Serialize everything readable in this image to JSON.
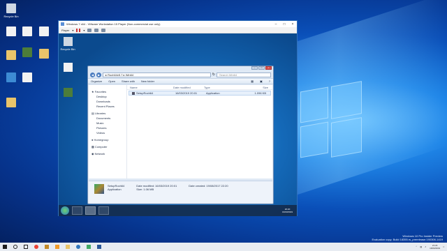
{
  "desktop_icons": [
    {
      "label": "Recycle Bin"
    },
    {
      "label": ""
    },
    {
      "label": ""
    },
    {
      "label": ""
    },
    {
      "label": ""
    },
    {
      "label": ""
    },
    {
      "label": ""
    },
    {
      "label": ""
    },
    {
      "label": ""
    },
    {
      "label": ""
    },
    {
      "label": ""
    },
    {
      "label": ""
    },
    {
      "label": ""
    },
    {
      "label": ""
    }
  ],
  "vmware": {
    "title": "Windows 7 x64 - VMware Workstation 15 Player (Non-commercial use only)",
    "player_menu": "Player",
    "guest_icons": [
      {
        "label": "Recycle Bin"
      },
      {
        "label": ""
      },
      {
        "label": ""
      }
    ]
  },
  "explorer": {
    "breadcrumb": [
      "Roch64v5.7",
      "Win64"
    ],
    "search_placeholder": "Search Win64",
    "commands": [
      "Organize",
      "Open",
      "Share with",
      "New folder"
    ],
    "nav": {
      "favorites": "Favorites",
      "favorites_items": [
        "Desktop",
        "Downloads",
        "Recent Places"
      ],
      "libraries": "Libraries",
      "libraries_items": [
        "Documents",
        "Music",
        "Pictures",
        "Videos"
      ],
      "homegroup": "Homegroup",
      "computer": "Computer",
      "network": "Network"
    },
    "columns": [
      "Name",
      "Date modified",
      "Type",
      "Size"
    ],
    "files": [
      {
        "name": "SetupRoch64",
        "date": "16/03/2019 20:01",
        "type": "Application",
        "size": "1.096 KB"
      }
    ],
    "details": {
      "name": "SetupRoch64",
      "type": "Application",
      "modified_label": "Date modified: 16/03/2019 20:01",
      "size_label": "Size: 1.06 MB",
      "created_label": "Date created: 19/08/2017 22:20"
    }
  },
  "guest_clock": {
    "time": "20:20",
    "date": "16/03/2019"
  },
  "host_clock": {
    "time": "21:24",
    "date": "16/03/2019"
  },
  "watermark": {
    "line1": "Windows 10 Pro Insider Preview",
    "line2": "Evaluation copy. Build 18355.rs_prerelease.190308-1419"
  },
  "colors": {
    "accent": "#0a4fb8",
    "titlebar": "#2f6fba"
  }
}
